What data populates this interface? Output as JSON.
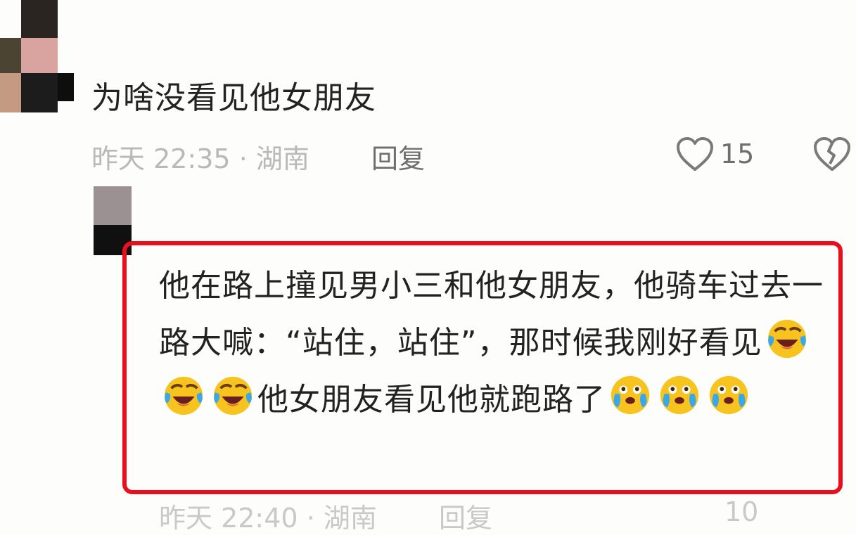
{
  "comment": {
    "text": "为啥没看见他女朋友",
    "time": "昨天 22:35",
    "location": "湖南",
    "reply_label": "回复",
    "like_count": "15",
    "icons": {
      "like": "heart-icon",
      "dislike": "broken-heart-icon"
    }
  },
  "reply": {
    "text_parts": [
      "他在路上撞见男小三和他女朋友，他骑车过去一路大喊：“站住，站住”，那时候我刚好看见",
      "他女朋友看见他就跑路了"
    ],
    "emoji_set_1": [
      "laughing-crying-emoji",
      "laughing-crying-emoji",
      "laughing-crying-emoji"
    ],
    "emoji_set_2": [
      "pleading-tears-emoji",
      "pleading-tears-emoji",
      "pleading-tears-emoji"
    ]
  },
  "next_meta": {
    "time": "昨天 22:40",
    "location": "湖南",
    "reply_label": "回复",
    "like_count": "10"
  },
  "colors": {
    "highlight": "#e8101e",
    "meta": "#b9b9b9",
    "text": "#222222"
  }
}
